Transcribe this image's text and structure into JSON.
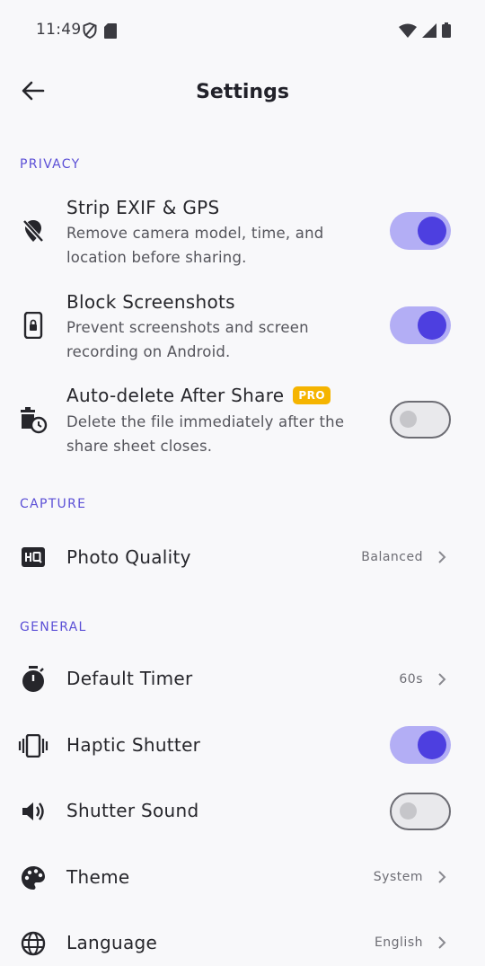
{
  "status_bar": {
    "time": "11:49",
    "icons": [
      "shield-icon",
      "sd-card-icon",
      "wifi-icon",
      "cell-signal-icon",
      "battery-icon"
    ]
  },
  "app_bar": {
    "title": "Settings",
    "back_icon": "arrow-left-icon"
  },
  "colors": {
    "accent": "#4d3fe0",
    "accent_track": "#b3aef5",
    "section_header": "#5b4fd6",
    "pro_badge": "#f5b400",
    "background": "#f8f8fa"
  },
  "sections": {
    "privacy": {
      "header": "PRIVACY",
      "strip_exif": {
        "title": "Strip EXIF & GPS",
        "subtitle": "Remove camera model, time, and location before sharing.",
        "icon": "location-off-icon",
        "enabled": true
      },
      "block_screenshots": {
        "title": "Block Screenshots",
        "subtitle": "Prevent screenshots and screen recording on Android.",
        "icon": "phone-lock-icon",
        "enabled": true
      },
      "auto_delete": {
        "title": "Auto-delete After Share",
        "badge": "PRO",
        "subtitle": "Delete the file immediately after the share sheet closes.",
        "icon": "delete-clock-icon",
        "enabled": false
      }
    },
    "capture": {
      "header": "CAPTURE",
      "photo_quality": {
        "title": "Photo Quality",
        "value": "Balanced",
        "icon": "hq-icon"
      }
    },
    "general": {
      "header": "GENERAL",
      "default_timer": {
        "title": "Default Timer",
        "value": "60s",
        "icon": "timer-icon"
      },
      "haptic_shutter": {
        "title": "Haptic Shutter",
        "icon": "vibration-icon",
        "enabled": true
      },
      "shutter_sound": {
        "title": "Shutter Sound",
        "icon": "volume-icon",
        "enabled": false
      },
      "theme": {
        "title": "Theme",
        "value": "System",
        "icon": "palette-icon"
      },
      "language": {
        "title": "Language",
        "value": "English",
        "icon": "globe-icon"
      }
    }
  }
}
